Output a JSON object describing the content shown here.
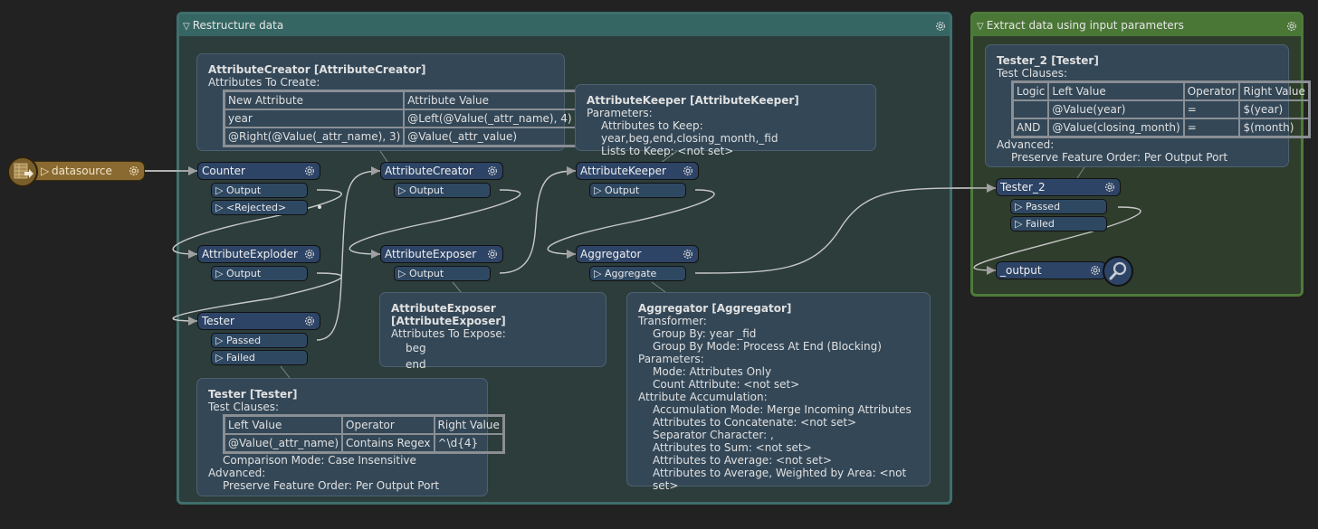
{
  "bookmarks": [
    {
      "title": "Restructure data",
      "color": "#356663"
    },
    {
      "title": "Extract data using input parameters",
      "color": "#4a7636"
    }
  ],
  "reader": {
    "name": "datasource",
    "icon": "table-reader-icon"
  },
  "transformers": {
    "counter": {
      "name": "Counter",
      "ports": [
        "Output",
        "<Rejected>"
      ]
    },
    "attribute_exploder": {
      "name": "AttributeExploder",
      "ports": [
        "Output"
      ]
    },
    "tester": {
      "name": "Tester",
      "ports": [
        "Passed",
        "Failed"
      ]
    },
    "attribute_creator": {
      "name": "AttributeCreator",
      "ports": [
        "Output"
      ]
    },
    "attribute_exposer": {
      "name": "AttributeExposer",
      "ports": [
        "Output"
      ]
    },
    "attribute_keeper": {
      "name": "AttributeKeeper",
      "ports": [
        "Output"
      ]
    },
    "aggregator": {
      "name": "Aggregator",
      "ports": [
        "Aggregate"
      ]
    },
    "tester_2": {
      "name": "Tester_2",
      "ports": [
        "Passed",
        "Failed"
      ]
    },
    "output": {
      "name": "_output"
    }
  },
  "annotations": {
    "attribute_creator": {
      "title": "AttributeCreator [AttributeCreator]",
      "subtitle": "Attributes To Create:",
      "table": {
        "headers": [
          "New Attribute",
          "Attribute Value"
        ],
        "rows": [
          [
            "year",
            "@Left(@Value(_attr_name), 4)"
          ],
          [
            "@Right(@Value(_attr_name), 3)",
            "@Value(_attr_value)"
          ]
        ]
      }
    },
    "attribute_keeper": {
      "title": "AttributeKeeper [AttributeKeeper]",
      "lines": [
        {
          "text": "Parameters:",
          "indent": 0
        },
        {
          "text": "Attributes to Keep: year,beg,end,closing_month,_fid",
          "indent": 1
        },
        {
          "text": "Lists to Keep: <not set>",
          "indent": 1
        }
      ]
    },
    "attribute_exposer": {
      "title": "AttributeExposer [AttributeExposer]",
      "subtitle": "Attributes To Expose:",
      "items": [
        "beg",
        "end"
      ]
    },
    "tester": {
      "title": "Tester [Tester]",
      "subtitle": "Test Clauses:",
      "table": {
        "headers": [
          "Left Value",
          "Operator",
          "Right Value"
        ],
        "rows": [
          [
            "@Value(_attr_name)",
            "Contains Regex",
            "^\\d{4}"
          ]
        ]
      },
      "after": [
        {
          "text": "Comparison Mode: Case Insensitive",
          "indent": 1
        },
        {
          "text": "Advanced:",
          "indent": 0
        },
        {
          "text": "Preserve Feature Order: Per Output Port",
          "indent": 1
        }
      ]
    },
    "aggregator": {
      "title": "Aggregator [Aggregator]",
      "lines": [
        {
          "text": "Transformer:",
          "indent": 0
        },
        {
          "text": "Group By: year _fid",
          "indent": 1
        },
        {
          "text": "Group By Mode: Process At End (Blocking)",
          "indent": 1
        },
        {
          "text": "Parameters:",
          "indent": 0
        },
        {
          "text": "Mode: Attributes Only",
          "indent": 1
        },
        {
          "text": "Count Attribute: <not set>",
          "indent": 1
        },
        {
          "text": "Attribute Accumulation:",
          "indent": 0
        },
        {
          "text": "Accumulation Mode: Merge Incoming Attributes",
          "indent": 1
        },
        {
          "text": "Attributes to Concatenate: <not set>",
          "indent": 1
        },
        {
          "text": "Separator Character: ,",
          "indent": 1
        },
        {
          "text": "Attributes to Sum: <not set>",
          "indent": 1
        },
        {
          "text": "Attributes to Average: <not set>",
          "indent": 1
        },
        {
          "text": "Attributes to Average, Weighted by Area: <not set>",
          "indent": 1
        }
      ]
    },
    "tester_2": {
      "title": "Tester_2 [Tester]",
      "subtitle": "Test Clauses:",
      "table": {
        "headers": [
          "Logic",
          "Left Value",
          "Operator",
          "Right Value"
        ],
        "rows": [
          [
            "",
            "@Value(year)",
            "=",
            "$(year)"
          ],
          [
            "AND",
            "@Value(closing_month)",
            "=",
            "$(month)"
          ]
        ]
      },
      "after": [
        {
          "text": "Advanced:",
          "indent": 0
        },
        {
          "text": "Preserve Feature Order: Per Output Port",
          "indent": 1
        }
      ]
    }
  }
}
